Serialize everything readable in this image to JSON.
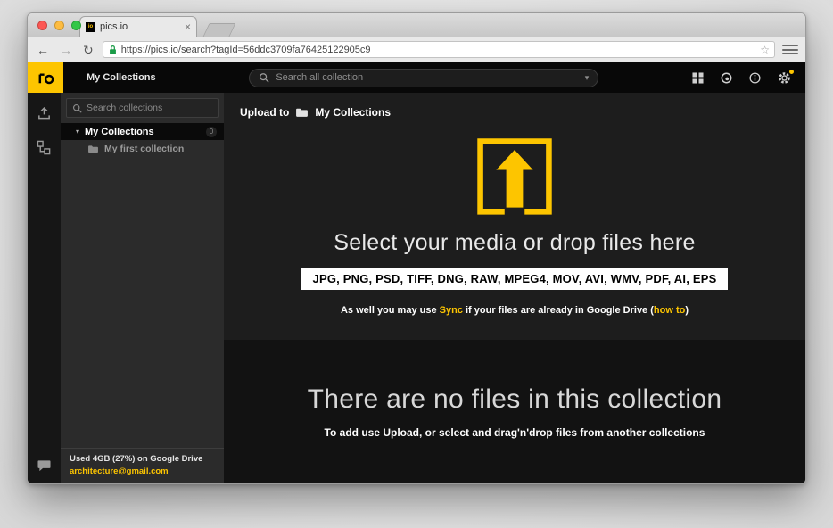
{
  "colors": {
    "accent": "#fdc500"
  },
  "browser": {
    "tab": {
      "title": "pics.io",
      "favicon_text": "io",
      "close_glyph": "×"
    },
    "toolbar": {
      "back_glyph": "←",
      "forward_glyph": "→",
      "refresh_glyph": "↻",
      "url": "https://pics.io/search?tagId=56ddc3709fa76425122905c9",
      "star_glyph": "☆"
    }
  },
  "header": {
    "title": "My Collections",
    "search": {
      "placeholder": "Search all collection",
      "caret_glyph": "▾"
    }
  },
  "collections_panel": {
    "search_placeholder": "Search collections",
    "root": {
      "caret_glyph": "▾",
      "label": "My Collections",
      "badge": "0"
    },
    "children": [
      {
        "label": "My first collection"
      }
    ],
    "storage": {
      "usage": "Used 4GB (27%) on Google Drive",
      "email": "architecture@gmail.com"
    }
  },
  "main": {
    "upload_to": {
      "label": "Upload to",
      "target": "My Collections"
    },
    "dropzone": {
      "title": "Select your media or drop files here",
      "formats": "JPG, PNG, PSD, TIFF, DNG, RAW, MPEG4, MOV, AVI, WMV, PDF, AI, EPS",
      "note": {
        "prefix": "As well you may use ",
        "sync": "Sync",
        "middle": " if your files are already in Google Drive (",
        "howto": "how to",
        "suffix": ")"
      }
    },
    "empty": {
      "title": "There are no files in this collection",
      "subtitle": "To add use Upload, or select and drag'n'drop files from another collections"
    }
  }
}
